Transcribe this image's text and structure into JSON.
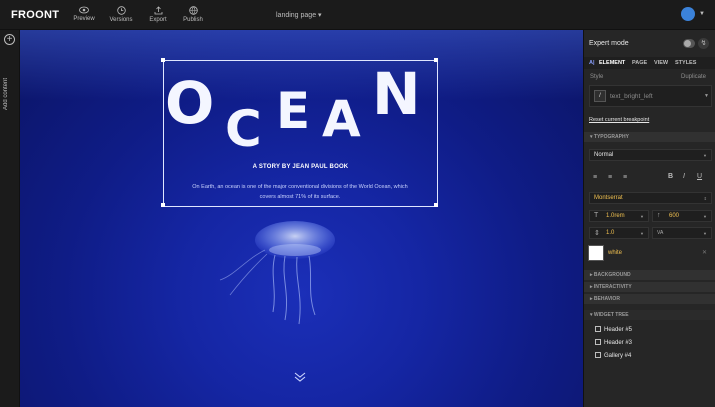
{
  "topbar": {
    "logo": "FROONT",
    "tools": [
      {
        "label": "Preview",
        "icon": "eye-icon"
      },
      {
        "label": "Versions",
        "icon": "history-icon"
      },
      {
        "label": "Export",
        "icon": "export-icon"
      },
      {
        "label": "Publish",
        "icon": "publish-icon"
      }
    ],
    "page_select": "landing page",
    "avatar_color": "#3b82d9"
  },
  "leftrail": {
    "add_content": "Add content"
  },
  "canvas": {
    "title_letters": [
      "O",
      "C",
      "E",
      "A",
      "N"
    ],
    "subtitle": "A STORY BY JEAN PAUL BOOK",
    "body_line1": "On Earth, an ocean is one of the major conventional divisions of the World Ocean, which",
    "body_line2": "covers almost 71% of its surface."
  },
  "panel": {
    "expert_mode": "Expert mode",
    "tabs": [
      "ELEMENT",
      "PAGE",
      "VIEW",
      "STYLES"
    ],
    "style_label": "Style",
    "duplicate": "Duplicate",
    "style_value": "text_bright_left",
    "reset": "Reset current breakpoint",
    "sections": {
      "typography": "TYPOGRAPHY",
      "background": "BACKGROUND",
      "interactivity": "INTERACTIVITY",
      "behavior": "BEHAVIOR",
      "widget_tree": "WIDGET TREE"
    },
    "text_style": "Normal",
    "font_family": "Montserrat",
    "font_size": "1.0rem",
    "font_weight": "600",
    "line_height": "1.0",
    "letter_spacing": "",
    "color_name": "white",
    "color_hex": "#ffffff",
    "widget_tree": [
      "Header #5",
      "Header #3",
      "Gallery #4"
    ]
  }
}
